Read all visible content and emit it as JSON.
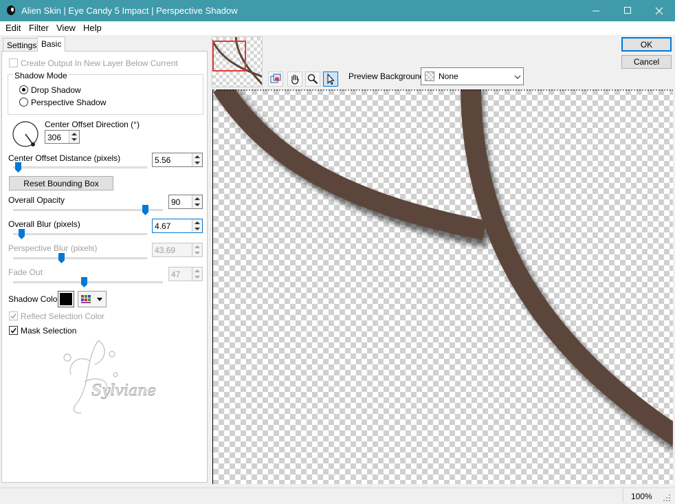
{
  "window": {
    "title": "Alien Skin | Eye Candy 5 Impact | Perspective Shadow"
  },
  "menu": [
    "Edit",
    "Filter",
    "View",
    "Help"
  ],
  "tabs": {
    "settings": "Settings",
    "basic": "Basic"
  },
  "panel": {
    "create_output_label": "Create Output In New Layer Below Current",
    "create_output_checked": false,
    "shadow_mode": {
      "title": "Shadow Mode",
      "drop_shadow": "Drop Shadow",
      "perspective_shadow": "Perspective Shadow",
      "selected": "Drop Shadow"
    },
    "center_offset_direction": {
      "label": "Center Offset Direction (°)",
      "value": "306"
    },
    "center_offset_distance": {
      "label": "Center Offset Distance (pixels)",
      "value": "5.56"
    },
    "reset_bounding_box": "Reset Bounding Box",
    "overall_opacity": {
      "label": "Overall Opacity",
      "value": "90"
    },
    "overall_blur": {
      "label": "Overall Blur (pixels)",
      "value": "4.67"
    },
    "perspective_blur": {
      "label": "Perspective Blur (pixels)",
      "value": "43.69"
    },
    "fade_out": {
      "label": "Fade Out",
      "value": "47"
    },
    "shadow_color": {
      "label": "Shadow Color",
      "color": "#000000"
    },
    "reflect_selection_color": {
      "label": "Reflect Selection Color",
      "checked": true,
      "enabled": false
    },
    "mask_selection": {
      "label": "Mask Selection",
      "checked": true
    },
    "watermark_text": "Sylviane"
  },
  "toolbar": {
    "preview_background_label": "Preview Background:",
    "preview_background_value": "None",
    "icons": [
      "navigate-icon",
      "hand-icon",
      "zoom-icon",
      "pointer-icon"
    ]
  },
  "buttons": {
    "ok": "OK",
    "cancel": "Cancel"
  },
  "status": {
    "zoom": "100%"
  },
  "colors": {
    "titlebar": "#3f9aaa",
    "accent": "#0078d7",
    "stroke": "#5c463b"
  }
}
